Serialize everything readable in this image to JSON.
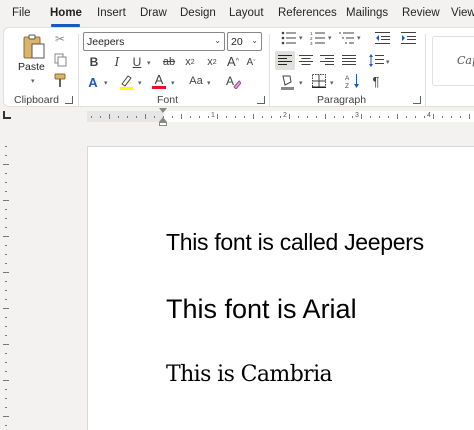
{
  "menu": {
    "tabs": [
      {
        "label": "File"
      },
      {
        "label": "Home"
      },
      {
        "label": "Insert"
      },
      {
        "label": "Draw"
      },
      {
        "label": "Design"
      },
      {
        "label": "Layout"
      },
      {
        "label": "References"
      },
      {
        "label": "Mailings"
      },
      {
        "label": "Review"
      },
      {
        "label": "View"
      }
    ],
    "active_tab": "Home"
  },
  "ribbon": {
    "clipboard": {
      "label": "Clipboard",
      "paste_label": "Paste"
    },
    "font": {
      "label": "Font",
      "font_name": "Jeepers",
      "font_size": "20",
      "bold_glyph": "B",
      "italic_glyph": "I",
      "underline_glyph": "U",
      "strike_glyph": "ab",
      "subscript_glyph": "x",
      "superscript_glyph": "x",
      "grow_glyph": "A",
      "shrink_glyph": "A",
      "case_glyph": "Aa",
      "highlight_color": "#ffff00",
      "font_color": "#e81123"
    },
    "paragraph": {
      "label": "Paragraph",
      "pilcrow": "¶"
    },
    "styles": {
      "preview": "Cap"
    }
  },
  "document": {
    "lines": [
      {
        "text": "This font is called Jeepers"
      },
      {
        "text": "This font is Arial"
      },
      {
        "text": "This is Cambria"
      }
    ]
  },
  "ruler": {
    "labels": [
      "1",
      "2",
      "3",
      "4"
    ]
  },
  "colors": {
    "accent": "#185abd",
    "ribbon_bg": "#ffffff",
    "app_bg": "#f3f2f1"
  }
}
